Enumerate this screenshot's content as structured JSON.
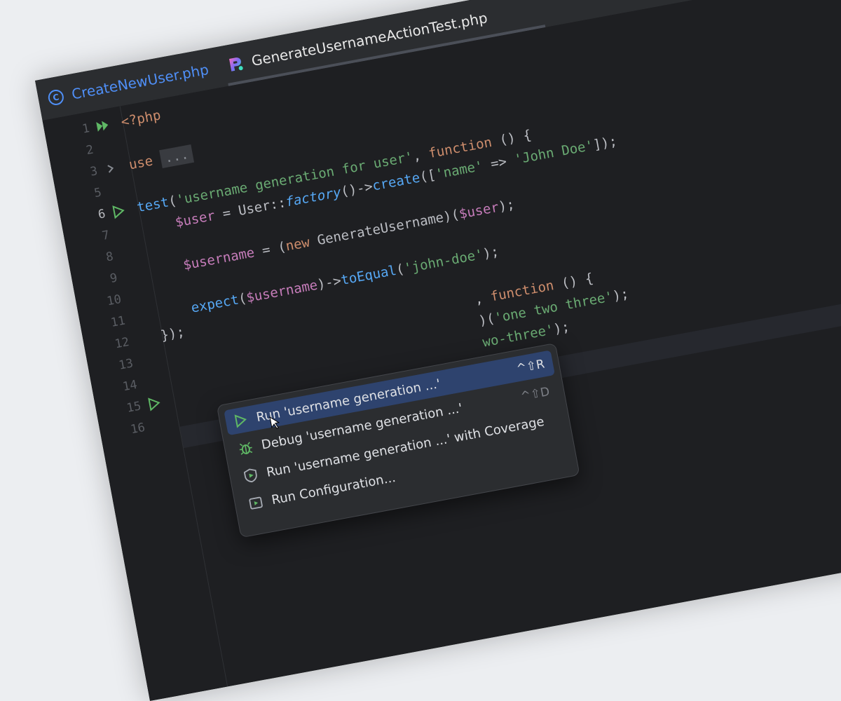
{
  "tabs": [
    {
      "label": "CreateNewUser.php",
      "icon": "class-c-icon",
      "active": false
    },
    {
      "label": "GenerateUsernameActionTest.php",
      "icon": "pest-file-icon",
      "active": true
    }
  ],
  "gutter": {
    "line_numbers": [
      "1",
      "2",
      "3",
      "5",
      "6",
      "7",
      "8",
      "9",
      "10",
      "11",
      "12",
      "13",
      "14",
      "15",
      "16"
    ]
  },
  "code": {
    "l1_open_tag": "<?php",
    "l3_use": "use",
    "l3_fold": "...",
    "l5_test": "test",
    "l5_open": "(",
    "l5_string": "'username generation for user'",
    "l5_comma": ", ",
    "l5_function": "function",
    "l5_close": " () {",
    "l6_var": "$user",
    "l6_eq": " = User::",
    "l6_factory": "factory",
    "l6_arrow": "()->",
    "l6_create": "create",
    "l6_open": "([",
    "l6_key": "'name'",
    "l6_fat": " => ",
    "l6_value": "'John Doe'",
    "l6_close": "]);",
    "l8_var": "$username",
    "l8_eq": " = (",
    "l8_new": "new",
    "l8_class": " GenerateUsername)(",
    "l8_arg": "$user",
    "l8_close": ");",
    "l10_expect": "expect",
    "l10_open": "(",
    "l10_var": "$username",
    "l10_arrow": ")->",
    "l10_toequal": "toEqual",
    "l10_open2": "(",
    "l10_value": "'john-doe'",
    "l10_close": ");",
    "l11_close": "});",
    "l14_comma": ", ",
    "l14_function": "function",
    "l14_close": " () {",
    "l15_paren": ")(",
    "l15_value": "'one two three'",
    "l15_close": ");",
    "l17_value": "wo-three'",
    "l17_close": ");"
  },
  "context_menu": {
    "items": [
      {
        "label": "Run 'username generation ...'",
        "shortcut": "^⇧R",
        "icon": "run-icon",
        "selected": true
      },
      {
        "label": "Debug 'username generation ...'",
        "shortcut": "^⇧D",
        "icon": "debug-bug-icon",
        "selected": false
      },
      {
        "label": "Run 'username generation ...' with Coverage",
        "shortcut": "",
        "icon": "coverage-icon",
        "selected": false
      },
      {
        "label": "Run Configuration...",
        "shortcut": "",
        "icon": "run-config-icon",
        "selected": false
      }
    ]
  },
  "colors": {
    "editor_bg": "#1e1f22",
    "keyword": "#cf8e6d",
    "string": "#6aab73",
    "function": "#56a8f5",
    "variable": "#c77dbb",
    "selection": "#2e436e",
    "run_green": "#5fb865"
  }
}
